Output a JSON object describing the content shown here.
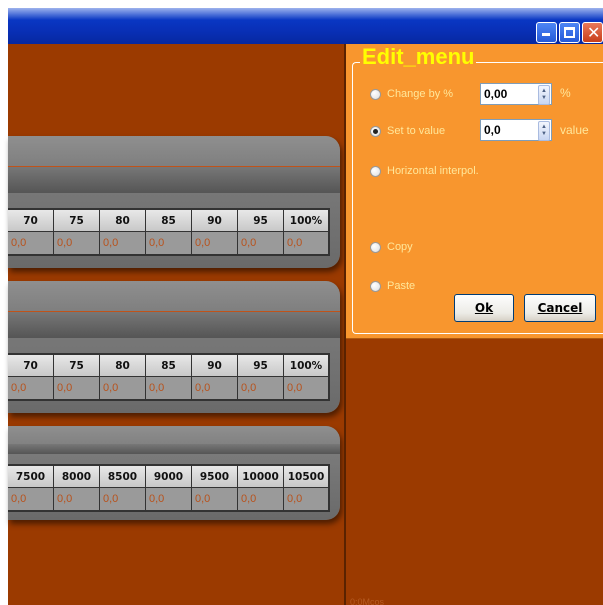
{
  "window": {
    "minimize_icon": "minimize-icon",
    "maximize_icon": "maximize-icon",
    "close_icon": "close-icon"
  },
  "tables": [
    {
      "headers": [
        "70",
        "75",
        "80",
        "85",
        "90",
        "95",
        "100%"
      ],
      "values": [
        "0,0",
        "0,0",
        "0,0",
        "0,0",
        "0,0",
        "0,0",
        "0,0"
      ]
    },
    {
      "headers": [
        "70",
        "75",
        "80",
        "85",
        "90",
        "95",
        "100%"
      ],
      "values": [
        "0,0",
        "0,0",
        "0,0",
        "0,0",
        "0,0",
        "0,0",
        "0,0"
      ]
    },
    {
      "headers": [
        "7500",
        "8000",
        "8500",
        "9000",
        "9500",
        "10000",
        "10500"
      ],
      "values": [
        "0,0",
        "0,0",
        "0,0",
        "0,0",
        "0,0",
        "0,0",
        "0,0"
      ]
    }
  ],
  "edit_menu": {
    "title": "Edit_menu",
    "change_by_label": "Change by %",
    "change_by_value": "0,00",
    "change_by_unit": "%",
    "set_to_label": "Set to value",
    "set_to_value": "0,0",
    "set_to_unit": "value",
    "horizontal_label": "Horizontal interpol.",
    "copy_label": "Copy",
    "paste_label": "Paste",
    "ok_label": "Ok",
    "cancel_label": "Cancel",
    "selected_option": "set_to_value"
  },
  "status_text": "0:0Mcos"
}
